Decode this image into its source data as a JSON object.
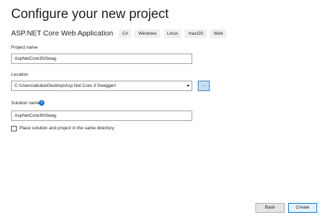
{
  "page": {
    "title": "Configure your new project"
  },
  "template": {
    "name": "ASP.NET Core Web Application",
    "tags": [
      "C#",
      "Windows",
      "Linux",
      "macOS",
      "Web"
    ]
  },
  "project_name": {
    "label": "Project name",
    "value": "AspNetCore3NSwag"
  },
  "location": {
    "label": "Location",
    "value": "C:\\Users\\abuba\\Desktop\\Asp Net Core 3 Swagger\\",
    "browse_label": "..."
  },
  "solution_name": {
    "label": "Solution name",
    "value": "AspNetCore3NSwag",
    "info_icon": "info-icon"
  },
  "same_directory": {
    "label": "Place solution and project in the same directory",
    "checked": false
  },
  "footer": {
    "back_label": "Back",
    "create_label": "Create"
  },
  "colors": {
    "accent": "#0078d7",
    "info": "#1e72c8",
    "browse_bg": "#c9def5"
  }
}
